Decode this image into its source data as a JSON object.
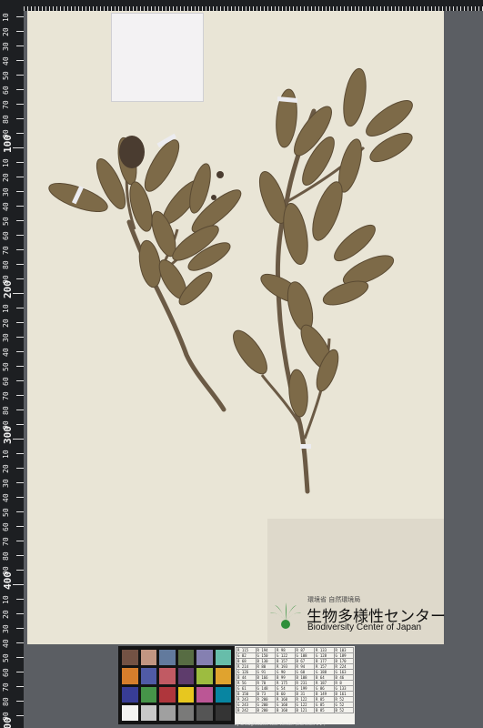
{
  "ruler": {
    "labels": [
      "10",
      "20",
      "30",
      "40",
      "50",
      "60",
      "70",
      "80",
      "90",
      "100",
      "10",
      "20",
      "30",
      "40",
      "50",
      "60",
      "70",
      "80",
      "90",
      "200",
      "10",
      "20",
      "30",
      "40",
      "50",
      "60",
      "70",
      "80",
      "90",
      "300",
      "10",
      "20",
      "30",
      "40",
      "50",
      "60",
      "70",
      "80",
      "90",
      "400",
      "10",
      "20",
      "30",
      "40",
      "50",
      "60",
      "70",
      "80",
      "90",
      "500"
    ]
  },
  "logo": {
    "agency_line": "環境省 自然環境局",
    "name_jp": "生物多様性センター",
    "name_en": "Biodiversity Center of Japan"
  },
  "color_checker": {
    "swatches": [
      "#735244",
      "#c29682",
      "#627a9d",
      "#576c43",
      "#8580b1",
      "#67bdaa",
      "#d67e2c",
      "#505ba6",
      "#c15a63",
      "#5e3c6c",
      "#9dbc40",
      "#e0a32e",
      "#383d96",
      "#469449",
      "#af363c",
      "#e7c71f",
      "#bb5695",
      "#0885a1",
      "#f3f3f2",
      "#c8c8c8",
      "#a0a0a0",
      "#7a7a79",
      "#555555",
      "#343434"
    ]
  },
  "color_table": {
    "rows": [
      [
        "R 115",
        "R 194",
        "R 98",
        "R 87",
        "R 133",
        "R 103"
      ],
      [
        "G 82",
        "G 150",
        "G 122",
        "G 108",
        "G 128",
        "G 189"
      ],
      [
        "B 68",
        "B 130",
        "B 157",
        "B 67",
        "B 177",
        "B 170"
      ],
      [
        "R 214",
        "R 80",
        "R 193",
        "R 94",
        "R 157",
        "R 224"
      ],
      [
        "G 126",
        "G 91",
        "G 90",
        "G 60",
        "G 188",
        "G 163"
      ],
      [
        "B 44",
        "B 166",
        "B 99",
        "B 108",
        "B 64",
        "B 46"
      ],
      [
        "R 56",
        "R 70",
        "R 175",
        "R 231",
        "R 187",
        "R 8"
      ],
      [
        "G 61",
        "G 148",
        "G 54",
        "G 199",
        "G 86",
        "G 133"
      ],
      [
        "B 150",
        "B 73",
        "B 60",
        "B 31",
        "B 149",
        "B 161"
      ],
      [
        "R 243",
        "R 200",
        "R 160",
        "R 122",
        "R 85",
        "R 52"
      ],
      [
        "G 243",
        "G 200",
        "G 160",
        "G 122",
        "G 85",
        "G 52"
      ],
      [
        "B 242",
        "B 200",
        "B 160",
        "B 121",
        "B 85",
        "B 52"
      ]
    ],
    "caption": "by GretagMacbeth color checker (Illuminant-C 2°)"
  }
}
